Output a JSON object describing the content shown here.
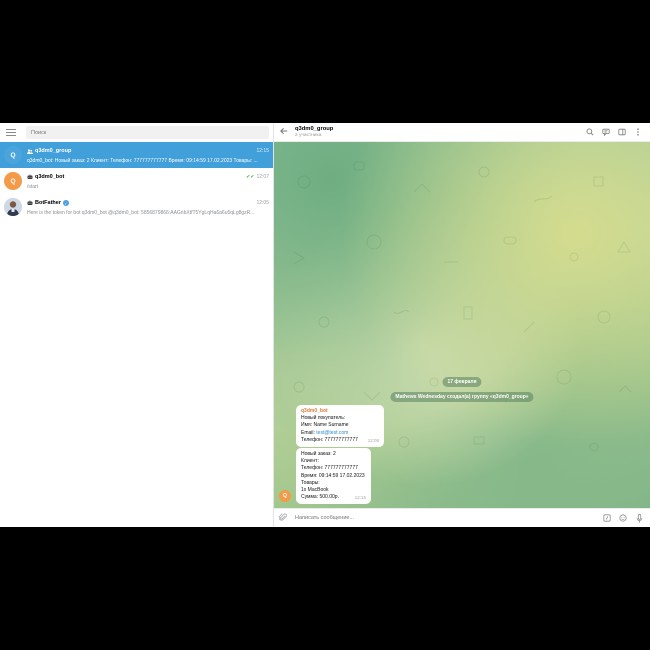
{
  "sidebar": {
    "search_placeholder": "Поиск",
    "chats": [
      {
        "avatar_letter": "Q",
        "avatar_color": "#4ba5dc",
        "name": "q3dm0_group",
        "time": "12:15",
        "preview": "q3dm0_bot: Новый заказ: 2 Клиент: Телефон: 777777777777 Время: 09:14:59 17.02.2023 Товары: ...",
        "active": true
      },
      {
        "avatar_letter": "Q",
        "avatar_color": "#f39b48",
        "name": "q3dm0_bot",
        "time": "12:07",
        "preview": "/start"
      },
      {
        "name": "BotFather",
        "time": "12:05",
        "preview": "Here is the token for bot q3dm0_bot @q3dm0_bot: 5856879866:AAGnbXtfT5YgLqHa6a6u5qLg8gzR..."
      }
    ]
  },
  "header": {
    "title": "q3dm0_group",
    "subtitle": "2 участника"
  },
  "messages": {
    "date": "17 февраля",
    "service": "Mathews Wednesday создал(а) группу «q3dm0_group»",
    "first": {
      "sender": "q3dm0_bot",
      "lines": [
        "Новый покупатель:",
        "Имя: Name Surname",
        "Email: ",
        "Телефон: 777777777777"
      ],
      "email": "test@test.com",
      "time": "12:08"
    },
    "second": {
      "lines": [
        "Новый заказ: 2",
        "Клиент:",
        "Телефон: 777777777777",
        "Время: 09:14:59 17.02.2023",
        "Товары:",
        "1x MacBook",
        "Сумма: 500.00р."
      ],
      "time": "12:15"
    },
    "sender_avatar_letter": "Q"
  },
  "composer": {
    "placeholder": "Написать сообщение..."
  },
  "colors": {
    "accent": "#419fd9",
    "bot_orange": "#f39b48"
  }
}
